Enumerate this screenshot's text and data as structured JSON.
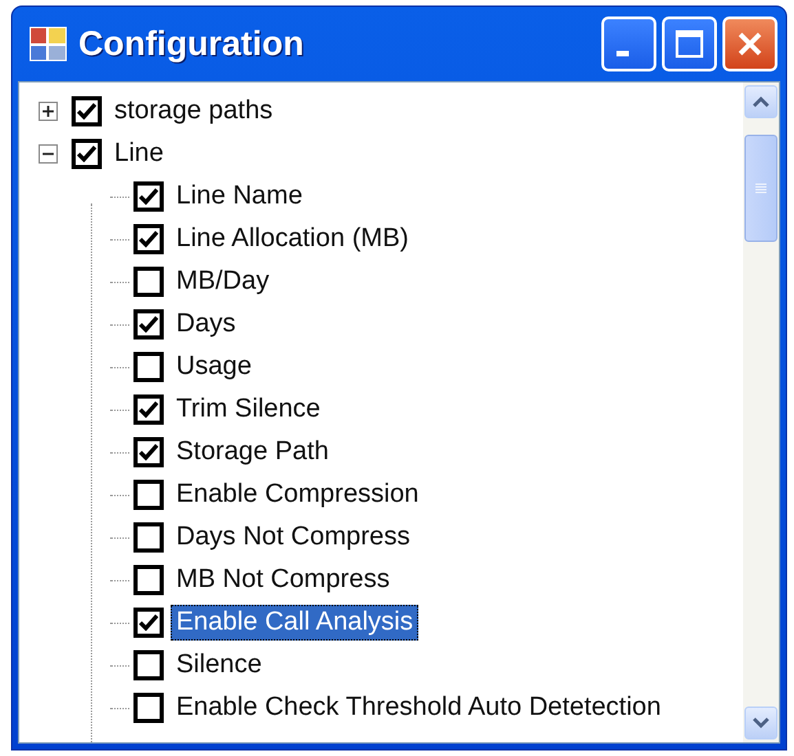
{
  "window": {
    "title": "Configuration"
  },
  "tree": [
    {
      "label": "storage paths",
      "checked": true,
      "expanded": false,
      "selected": false
    },
    {
      "label": "Line",
      "checked": true,
      "expanded": true,
      "selected": false,
      "children": [
        {
          "label": "Line Name",
          "checked": true,
          "selected": false
        },
        {
          "label": "Line Allocation (MB)",
          "checked": true,
          "selected": false
        },
        {
          "label": "MB/Day",
          "checked": false,
          "selected": false
        },
        {
          "label": "Days",
          "checked": true,
          "selected": false
        },
        {
          "label": "Usage",
          "checked": false,
          "selected": false
        },
        {
          "label": "Trim Silence",
          "checked": true,
          "selected": false
        },
        {
          "label": "Storage Path",
          "checked": true,
          "selected": false
        },
        {
          "label": "Enable Compression",
          "checked": false,
          "selected": false
        },
        {
          "label": "Days Not Compress",
          "checked": false,
          "selected": false
        },
        {
          "label": "MB Not Compress",
          "checked": false,
          "selected": false
        },
        {
          "label": "Enable Call Analysis",
          "checked": true,
          "selected": true
        },
        {
          "label": "Silence",
          "checked": false,
          "selected": false
        },
        {
          "label": "Enable Check Threshold Auto Detetection",
          "checked": false,
          "selected": false
        }
      ]
    }
  ]
}
